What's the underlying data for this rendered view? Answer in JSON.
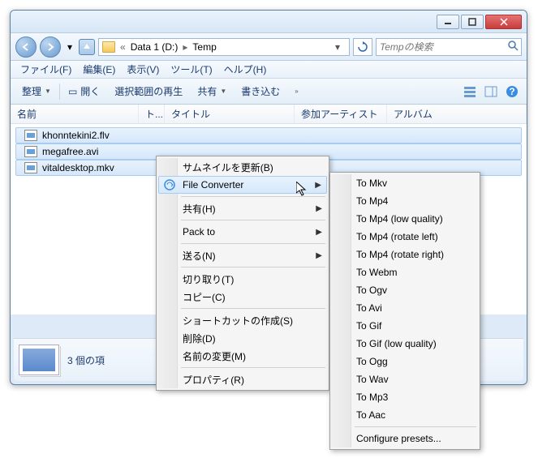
{
  "address": {
    "sep": "«",
    "drive": "Data 1 (D:)",
    "arrow": "▸",
    "folder": "Temp"
  },
  "search": {
    "placeholder": "Tempの検索"
  },
  "menubar": {
    "file": "ファイル(F)",
    "edit": "編集(E)",
    "view": "表示(V)",
    "tools": "ツール(T)",
    "help": "ヘルプ(H)"
  },
  "toolbar": {
    "organize": "整理",
    "open": "開く",
    "playsel": "選択範囲の再生",
    "share": "共有",
    "burn": "書き込む"
  },
  "columns": {
    "name": "名前",
    "t": "ト...",
    "title": "タイトル",
    "artist": "参加アーティスト",
    "album": "アルバム"
  },
  "files": [
    {
      "name": "khonntekini2.flv"
    },
    {
      "name": "megafree.avi"
    },
    {
      "name": "vitaldesktop.mkv"
    }
  ],
  "details": {
    "count": "3 個の項"
  },
  "ctx": {
    "updatethumb": "サムネイルを更新(B)",
    "fileconverter": "File Converter",
    "share": "共有(H)",
    "packto": "Pack to",
    "sendto": "送る(N)",
    "cut": "切り取り(T)",
    "copy": "コピー(C)",
    "shortcut": "ショートカットの作成(S)",
    "delete": "削除(D)",
    "rename": "名前の変更(M)",
    "properties": "プロパティ(R)"
  },
  "sub": {
    "mkv": "To Mkv",
    "mp4": "To Mp4",
    "mp4lq": "To Mp4 (low quality)",
    "mp4rl": "To Mp4 (rotate left)",
    "mp4rr": "To Mp4 (rotate right)",
    "webm": "To Webm",
    "ogv": "To Ogv",
    "avi": "To Avi",
    "gif": "To Gif",
    "giflq": "To Gif (low quality)",
    "ogg": "To Ogg",
    "wav": "To Wav",
    "mp3": "To Mp3",
    "aac": "To Aac",
    "config": "Configure presets..."
  }
}
